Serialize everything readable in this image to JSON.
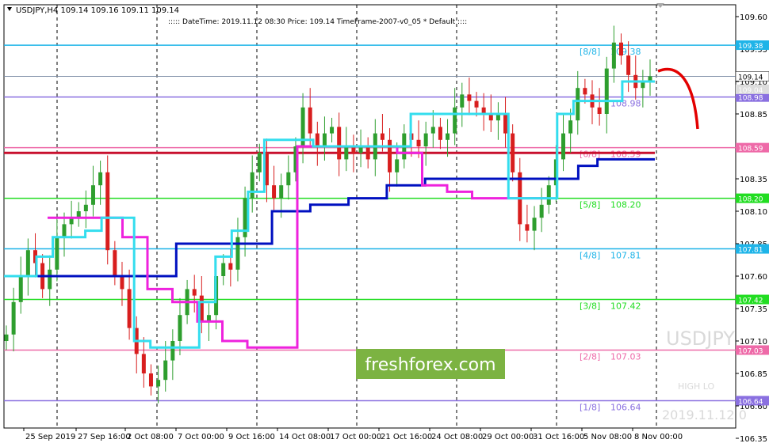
{
  "header": {
    "symbol_info": "USDJPY,H4  109.14 109.16 109.11 109.14",
    "indicator_info": "::::: DateTime: 2019.11.12 08:30   Price: 109.14   TimeFrame-2007-v0_05    *  Default    ::::"
  },
  "watermark": {
    "symbol": "USDJPY",
    "timestamp": "2019.11.12 0",
    "high_low": "HIGH        LO"
  },
  "brand": {
    "text": "freshforex.com",
    "color": "#7cb342"
  },
  "colors": {
    "bull": "#2e9e2e",
    "bear": "#d81e1e",
    "cyan_line": "#33ddee",
    "magenta_line": "#ee22dd",
    "blue_line": "#0010c0",
    "red_hline": "#c8102e",
    "arrow": "#e30000",
    "current_price": "#8090a8"
  },
  "chart_data": {
    "type": "candlestick",
    "title": "USDJPY,H4",
    "ylim": [
      106.35,
      109.72
    ],
    "y_ticks": [
      "109.60",
      "109.35",
      "109.10",
      "108.85",
      "108.60",
      "108.35",
      "108.10",
      "107.85",
      "107.60",
      "107.35",
      "107.10",
      "106.85",
      "106.60",
      "106.35"
    ],
    "x_ticks": [
      "25 Sep 2019",
      "27 Sep 16:00",
      "2 Oct 08:00",
      "7 Oct 00:00",
      "9 Oct 16:00",
      "14 Oct 08:00",
      "17 Oct 00:00",
      "21 Oct 16:00",
      "24 Oct 08:00",
      "29 Oct 00:00",
      "31 Oct 16:00",
      "5 Nov 08:00",
      "8 Nov 00:00"
    ],
    "current_price": {
      "value": 109.14,
      "label": "109.14"
    },
    "levels": [
      {
        "value": 109.38,
        "label": "109.38",
        "tag": "[8/8]",
        "tag_text": "109.38",
        "color": "#1eb4e8"
      },
      {
        "value": 108.98,
        "label": "108.98",
        "tag": "",
        "tag_text": "108.98",
        "color": "#8a70e0"
      },
      {
        "value": 108.59,
        "label": "108.59",
        "tag": "[6/8]",
        "tag_text": "108.59",
        "color": "#ee6aa8"
      },
      {
        "value": 108.2,
        "label": "108.20",
        "tag": "[5/8]",
        "tag_text": "108.20",
        "color": "#22dd22"
      },
      {
        "value": 107.81,
        "label": "107.81",
        "tag": "[4/8]",
        "tag_text": "107.81",
        "color": "#1eb4e8"
      },
      {
        "value": 107.42,
        "label": "107.42",
        "tag": "[3/8]",
        "tag_text": "107.42",
        "color": "#22dd22"
      },
      {
        "value": 107.03,
        "label": "107.03",
        "tag": "[2/8]",
        "tag_text": "107.03",
        "color": "#ee6aa8"
      },
      {
        "value": 106.64,
        "label": "106.64",
        "tag": "[1/8]",
        "tag_text": "106.64",
        "color": "#8a70e0"
      }
    ],
    "extra_level": {
      "value": 109.04,
      "label": "109.04"
    },
    "red_hline": {
      "value": 108.55
    },
    "closes": [
      107.15,
      107.4,
      107.6,
      107.8,
      107.7,
      107.5,
      107.65,
      107.9,
      108.0,
      108.05,
      108.1,
      108.15,
      108.3,
      108.4,
      107.8,
      107.6,
      107.5,
      107.2,
      107.0,
      106.85,
      106.75,
      106.8,
      106.95,
      107.1,
      107.3,
      107.5,
      107.45,
      107.25,
      107.3,
      107.6,
      107.7,
      107.65,
      107.9,
      108.2,
      108.4,
      108.55,
      108.3,
      108.2,
      108.3,
      108.4,
      108.6,
      108.9,
      108.7,
      108.6,
      108.7,
      108.75,
      108.5,
      108.6,
      108.55,
      108.6,
      108.5,
      108.7,
      108.65,
      108.4,
      108.5,
      108.7,
      108.65,
      108.6,
      108.7,
      108.75,
      108.65,
      108.7,
      108.9,
      109.0,
      108.95,
      108.9,
      108.85,
      108.8,
      108.85,
      108.7,
      108.4,
      108.0,
      107.95,
      108.05,
      108.15,
      108.3,
      108.5,
      108.7,
      108.8,
      109.05,
      109.0,
      108.9,
      108.85,
      109.2,
      109.4,
      109.3,
      109.15,
      109.05,
      109.1,
      109.14
    ],
    "cyan_series": [
      107.6,
      107.6,
      107.75,
      107.9,
      107.9,
      107.95,
      108.05,
      108.05,
      107.1,
      107.05,
      107.05,
      107.05,
      107.4,
      107.75,
      107.95,
      108.25,
      108.65,
      108.65,
      108.65,
      108.6,
      108.6,
      108.6,
      108.6,
      108.6,
      108.6,
      108.85,
      108.85,
      108.85,
      108.85,
      108.85,
      108.85,
      108.2,
      108.2,
      108.2,
      108.85,
      108.95,
      108.95,
      108.95,
      109.1,
      109.1
    ],
    "magenta_series": [
      108.05,
      108.05,
      108.05,
      107.9,
      107.5,
      107.4,
      107.25,
      107.1,
      107.05,
      107.05,
      108.6,
      108.6,
      108.6,
      108.6,
      108.55,
      108.3,
      108.25,
      108.2,
      108.2,
      108.2
    ],
    "blue_series": [
      107.6,
      107.6,
      107.6,
      107.6,
      107.6,
      107.6,
      107.6,
      107.6,
      107.6,
      107.85,
      107.85,
      107.85,
      107.85,
      107.85,
      108.1,
      108.1,
      108.15,
      108.15,
      108.2,
      108.2,
      108.3,
      108.3,
      108.35,
      108.35,
      108.35,
      108.35,
      108.35,
      108.35,
      108.35,
      108.35,
      108.45,
      108.5,
      108.5,
      108.5
    ]
  }
}
